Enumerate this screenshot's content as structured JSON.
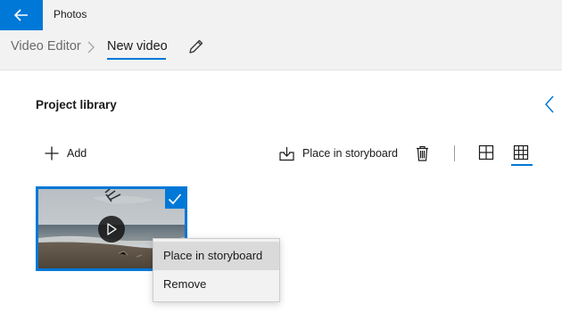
{
  "app": {
    "title": "Photos"
  },
  "breadcrumb": {
    "root": "Video Editor",
    "current": "New video"
  },
  "library": {
    "title": "Project library",
    "toolbar": {
      "add_label": "Add",
      "place_label": "Place in storyboard"
    }
  },
  "context_menu": {
    "items": [
      "Place in storyboard",
      "Remove"
    ]
  },
  "colors": {
    "accent": "#0078d7",
    "chrome": "#f2f2f2"
  }
}
